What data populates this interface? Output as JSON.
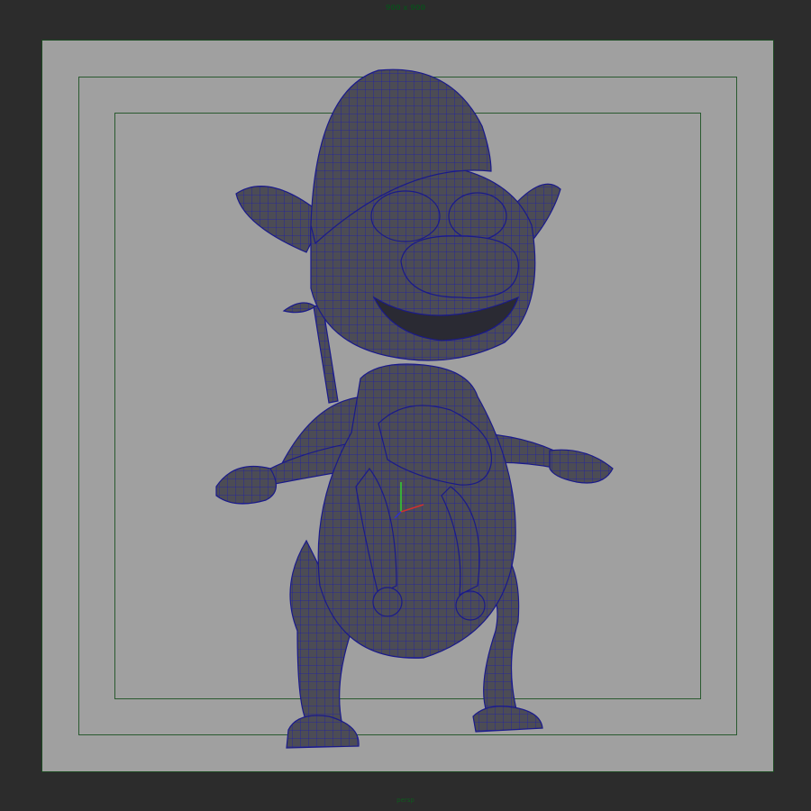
{
  "viewport": {
    "resolution_label": "900 x 900",
    "camera_label": "persp"
  },
  "colors": {
    "background": "#2c2c2c",
    "gate_fill": "#a0a0a0",
    "gate_border": "#1c4a22",
    "mesh_fill": "#4a4a52",
    "wireframe": "#1a1aa0"
  }
}
